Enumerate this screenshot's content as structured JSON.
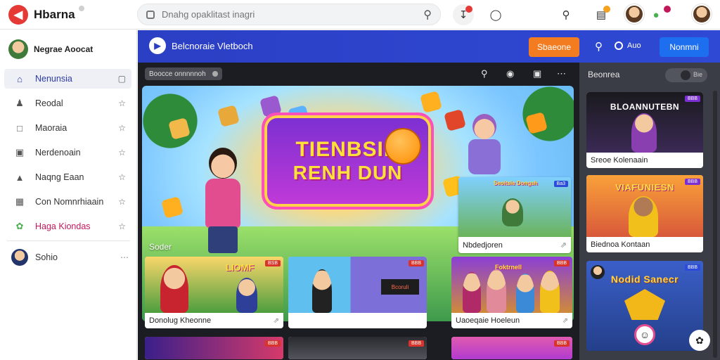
{
  "app": {
    "name": "Hbarna",
    "logo_glyph": "◀"
  },
  "search": {
    "placeholder": "Dnahg opaklitast inagri"
  },
  "header_icons": [
    "download-icon",
    "chat-icon",
    "search-icon",
    "notes-icon",
    "avatar",
    "puzzle-icon",
    "avatar"
  ],
  "sidebar": {
    "profile_name": "Negrae Aoocat",
    "items": [
      {
        "label": "Nenunsia",
        "icon": "home-icon",
        "active": true
      },
      {
        "label": "Reodal",
        "icon": "people-icon"
      },
      {
        "label": "Maoraia",
        "icon": "bookmark-icon"
      },
      {
        "label": "Nerdenoain",
        "icon": "folder-icon"
      },
      {
        "label": "Naqng Eaan",
        "icon": "pin-icon"
      },
      {
        "label": "Con Nomnrhiaain",
        "icon": "folder-icon"
      },
      {
        "label": "Haga Kiondas",
        "icon": "flower-icon",
        "highlight": true
      }
    ],
    "user_label": "Sohio"
  },
  "content_header": {
    "title": "Belcnoraie Vletboch",
    "primary_btn": "Sbaeone",
    "auto_label": "Auo",
    "secondary_btn": "Nonmni"
  },
  "main": {
    "pill_label": "Boocce onnnnnoh",
    "hero": {
      "sign_line1": "TIENBSIN",
      "sign_line2": "RENH DUN",
      "caption": "Soder",
      "side_card_title": "Nbdedjoren",
      "side_card_chip": "Ba3",
      "side_card_banner": "Seoitsie Dongsh"
    },
    "grid": [
      {
        "title": "Donolug Kheonne",
        "chip": "BSB",
        "banner": "LIOMF"
      },
      {
        "title": "",
        "chip": "BBB",
        "banner": "Bcoruli"
      },
      {
        "title": "Uaoeqaie Hoeleun",
        "chip": "BBB",
        "banner": "Foktrnell"
      },
      {
        "title": "",
        "chip": "BBB",
        "banner": ""
      },
      {
        "title": "",
        "chip": "BBB",
        "banner": ""
      },
      {
        "title": "",
        "chip": "BBB",
        "banner": ""
      }
    ]
  },
  "right_panel": {
    "heading": "Beonrea",
    "toggle_label": "Bie",
    "cards": [
      {
        "title": "Sreoe Kolenaain",
        "banner": "BLOANNUTEBN",
        "chip": "BBB"
      },
      {
        "title": "Biednoa Kontaan",
        "banner": "VIAFUNIESN",
        "chip": "BBB"
      },
      {
        "title": "",
        "banner": "Nodid Sanecr",
        "chip": "BBB"
      }
    ]
  },
  "colors": {
    "brand_blue": "#2b3fc4",
    "accent_orange": "#f47c20",
    "action_blue": "#1e6ff0",
    "danger": "#d8342b"
  }
}
